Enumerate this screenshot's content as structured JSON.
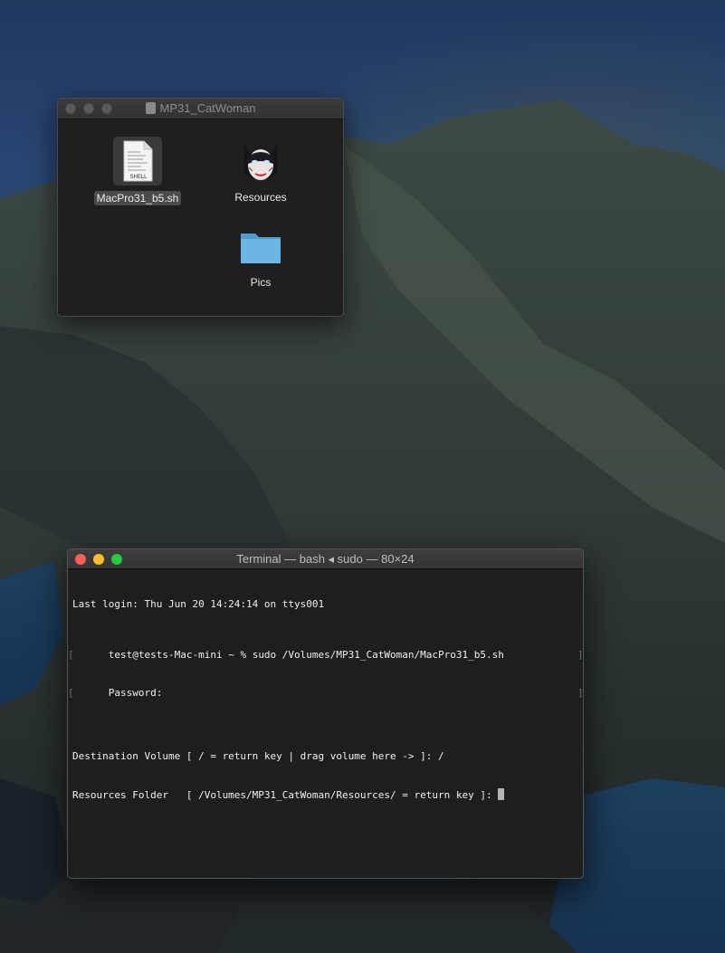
{
  "finder": {
    "title": "MP31_CatWoman",
    "items": [
      {
        "label": "MacPro31_b5.sh",
        "icon": "shell-script-file-icon",
        "icon_text": "SHELL",
        "selected": true
      },
      {
        "label": "Resources",
        "icon": "catwoman-image-icon",
        "selected": false
      },
      {
        "label": "Pics",
        "icon": "blue-folder-icon",
        "selected": false
      }
    ]
  },
  "terminal": {
    "title": "Terminal — bash ◂ sudo — 80×24",
    "lines": [
      "Last login: Thu Jun 20 14:24:14 on ttys001",
      "test@tests-Mac-mini ~ % sudo /Volumes/MP31_CatWoman/MacPro31_b5.sh",
      "Password:",
      "",
      "Destination Volume [ / = return key | drag volume here -> ]: /",
      "Resources Folder   [ /Volumes/MP31_CatWoman/Resources/ = return key ]: "
    ],
    "bracket_char": "[",
    "bracket_close_char": "]"
  },
  "colors": {
    "close": "#fe5f57",
    "minimize": "#febc2e",
    "zoom": "#28c840",
    "folder": "#6cb6e3"
  }
}
